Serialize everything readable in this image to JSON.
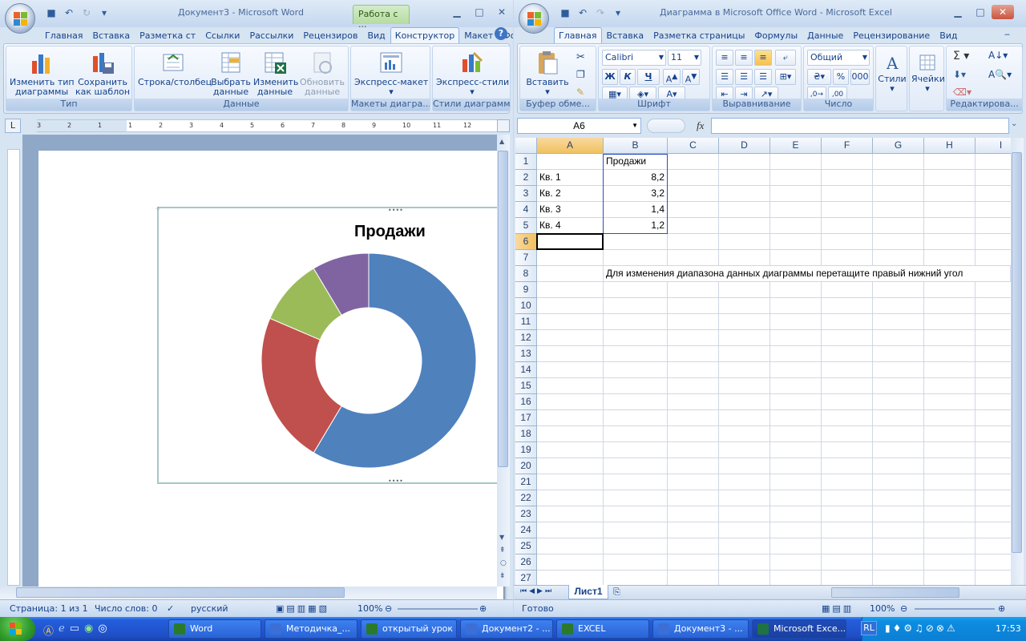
{
  "word": {
    "title": "Документ3 - Microsoft Word",
    "context_tab": "Работа с ...",
    "tabs": [
      "Главная",
      "Вставка",
      "Разметка ст",
      "Ссылки",
      "Рассылки",
      "Рецензиров",
      "Вид",
      "Конструктор",
      "Макет",
      "Формат"
    ],
    "groups": {
      "type": {
        "label": "Тип",
        "change_type": "Изменить тип\nдиаграммы",
        "save_template": "Сохранить\nкак шаблон"
      },
      "data": {
        "label": "Данные",
        "row_col": "Строка/столбец",
        "select": "Выбрать\nданные",
        "edit": "Изменить\nданные",
        "refresh": "Обновить\nданные"
      },
      "layouts": {
        "label": "Макеты диагра...",
        "express": "Экспресс-макет"
      },
      "styles": {
        "label": "Стили диаграмм",
        "express": "Экспресс-стили"
      }
    },
    "ruler_numbers": [
      "3",
      "2",
      "1",
      "1",
      "2",
      "3",
      "4",
      "5",
      "6",
      "7",
      "8",
      "9",
      "10",
      "11",
      "12"
    ],
    "chart_title": "Продажи",
    "status": {
      "page": "Страница: 1 из 1",
      "words": "Число слов: 0",
      "lang": "русский",
      "zoom": "100%"
    }
  },
  "chart_data": {
    "type": "donut",
    "title": "Продажи",
    "categories": [
      "Кв. 1",
      "Кв. 2",
      "Кв. 3",
      "Кв. 4"
    ],
    "values": [
      8.2,
      3.2,
      1.4,
      1.2
    ],
    "colors": [
      "#4f81bd",
      "#c0504d",
      "#9bbb59",
      "#8064a2"
    ]
  },
  "excel": {
    "title": "Диаграмма в Microsoft Office Word - Microsoft Excel",
    "tabs": [
      "Главная",
      "Вставка",
      "Разметка страницы",
      "Формулы",
      "Данные",
      "Рецензирование",
      "Вид"
    ],
    "groups": {
      "clipboard": {
        "label": "Буфер обме...",
        "paste": "Вставить"
      },
      "font": {
        "label": "Шрифт",
        "name": "Calibri",
        "size": "11",
        "bold": "Ж",
        "italic": "К",
        "underline": "Ч"
      },
      "align": {
        "label": "Выравнивание"
      },
      "number": {
        "label": "Число",
        "format": "Общий"
      },
      "styles": {
        "label": "Стили"
      },
      "cells": {
        "label": "Ячейки"
      },
      "edit": {
        "label": "Редактирова..."
      }
    },
    "namebox": "A6",
    "fx": "fx",
    "columns": [
      "A",
      "B",
      "C",
      "D",
      "E",
      "F",
      "G",
      "H",
      "I"
    ],
    "rows": [
      "1",
      "2",
      "3",
      "4",
      "5",
      "6",
      "7",
      "8",
      "9",
      "10",
      "11",
      "12",
      "13",
      "14",
      "15",
      "16",
      "17",
      "18",
      "19",
      "20",
      "21",
      "22",
      "23",
      "24",
      "25",
      "26",
      "27"
    ],
    "cells": {
      "B1": "Продажи",
      "A2": "Кв. 1",
      "B2": "8,2",
      "A3": "Кв. 2",
      "B3": "3,2",
      "A4": "Кв. 3",
      "B4": "1,4",
      "A5": "Кв. 4",
      "B5": "1,2",
      "B8": "Для изменения диапазона данных диаграммы перетащите правый нижний угол"
    },
    "sheet_tab": "Лист1",
    "status": {
      "ready": "Готово",
      "zoom": "100%"
    }
  },
  "taskbar": {
    "items": [
      "Word",
      "Методичка_...",
      "открытый урок",
      "Документ2 - ...",
      "EXCEL",
      "Документ3 - ...",
      "Microsoft Exce..."
    ],
    "lang": "RL",
    "clock": "17:53"
  }
}
